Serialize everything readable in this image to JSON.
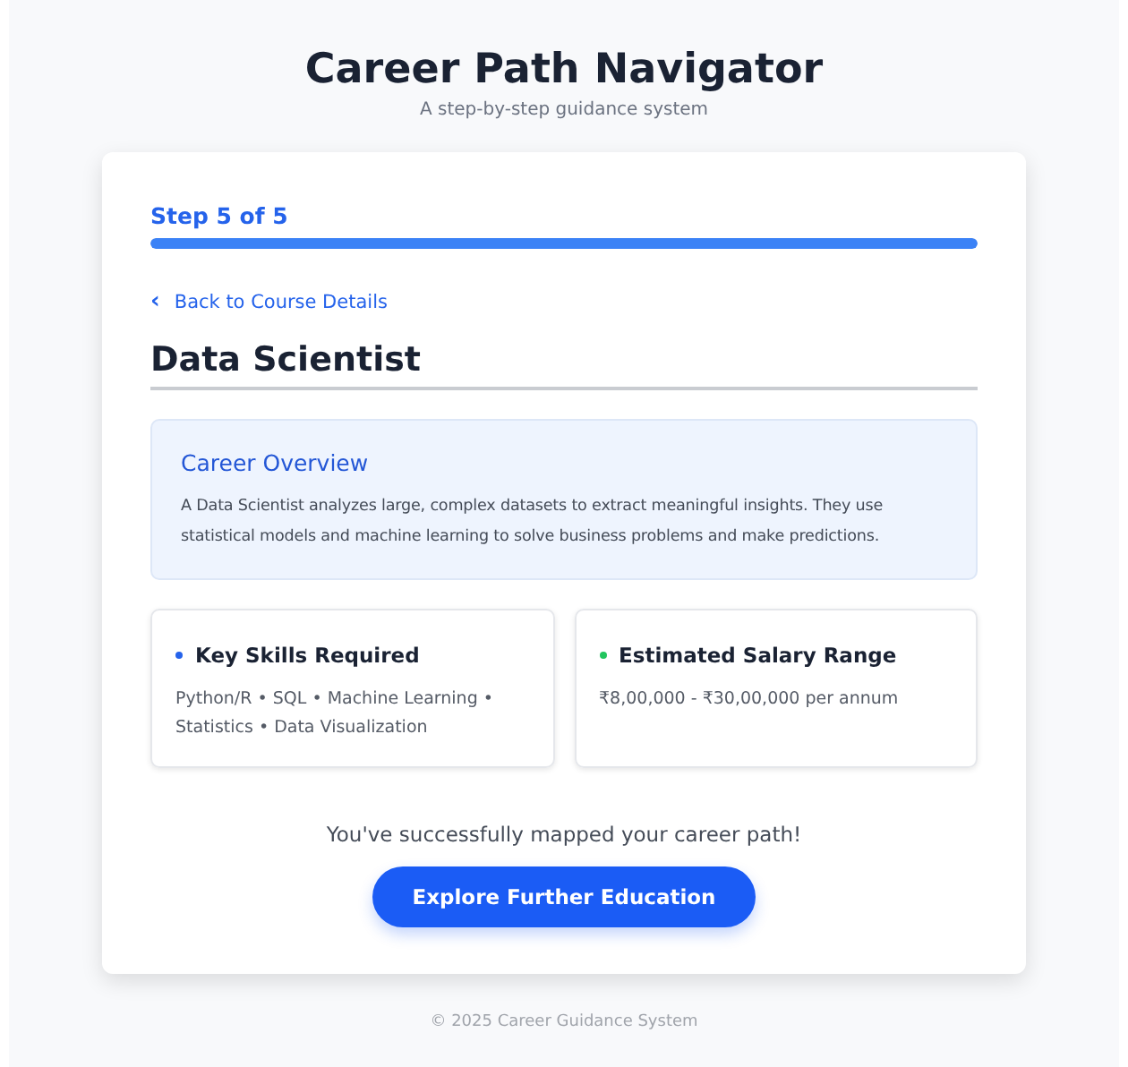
{
  "header": {
    "title": "Career Path Navigator",
    "subtitle": "A step-by-step guidance system"
  },
  "progress": {
    "label": "Step 5 of 5",
    "level": 1.0
  },
  "back_link": {
    "icon": "‹",
    "label": "Back to Course Details"
  },
  "career_title": "Data Scientist",
  "overview": {
    "title": "Career Overview",
    "text": "A Data Scientist analyzes large, complex datasets to extract meaningful insights. They use statistical models and machine learning to solve business problems and make predictions."
  },
  "info_cards": [
    {
      "title": "Key Skills Required",
      "color": "#2563eb",
      "text": "Python/R • SQL • Machine Learning • Statistics • Data Visualization"
    },
    {
      "title": "Estimated Salary Range",
      "color": "#22c55e",
      "text": "₹8,00,000 - ₹30,00,000 per annum"
    }
  ],
  "success_message": "You've successfully mapped your career path!",
  "action_button": "Explore Further Education",
  "footer": "© 2025 Career Guidance System"
}
